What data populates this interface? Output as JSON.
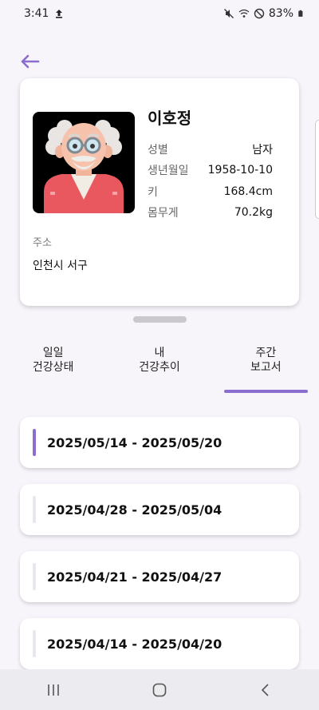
{
  "status_bar": {
    "time": "3:41",
    "battery": "83%"
  },
  "profile": {
    "name": "이호정",
    "fields": [
      {
        "label": "성별",
        "value": "남자"
      },
      {
        "label": "생년월일",
        "value": "1958-10-10"
      },
      {
        "label": "키",
        "value": "168.4cm"
      },
      {
        "label": "몸무게",
        "value": "70.2kg"
      }
    ],
    "address_label": "주소",
    "address_value": "인천시 서구"
  },
  "tabs": [
    {
      "line1": "일일",
      "line2": "건강상태"
    },
    {
      "line1": "내",
      "line2": "건강추이"
    },
    {
      "line1": "주간",
      "line2": "보고서"
    }
  ],
  "active_tab": "주간 보고서",
  "reports": [
    {
      "label": "2025/05/14 - 2025/05/20"
    },
    {
      "label": "2025/04/28 - 2025/05/04"
    },
    {
      "label": "2025/04/21 - 2025/04/27"
    },
    {
      "label": "2025/04/14 - 2025/04/20"
    }
  ],
  "colors": {
    "accent": "#8b6ccf",
    "background": "#f7f5fa",
    "card": "#ffffff"
  }
}
